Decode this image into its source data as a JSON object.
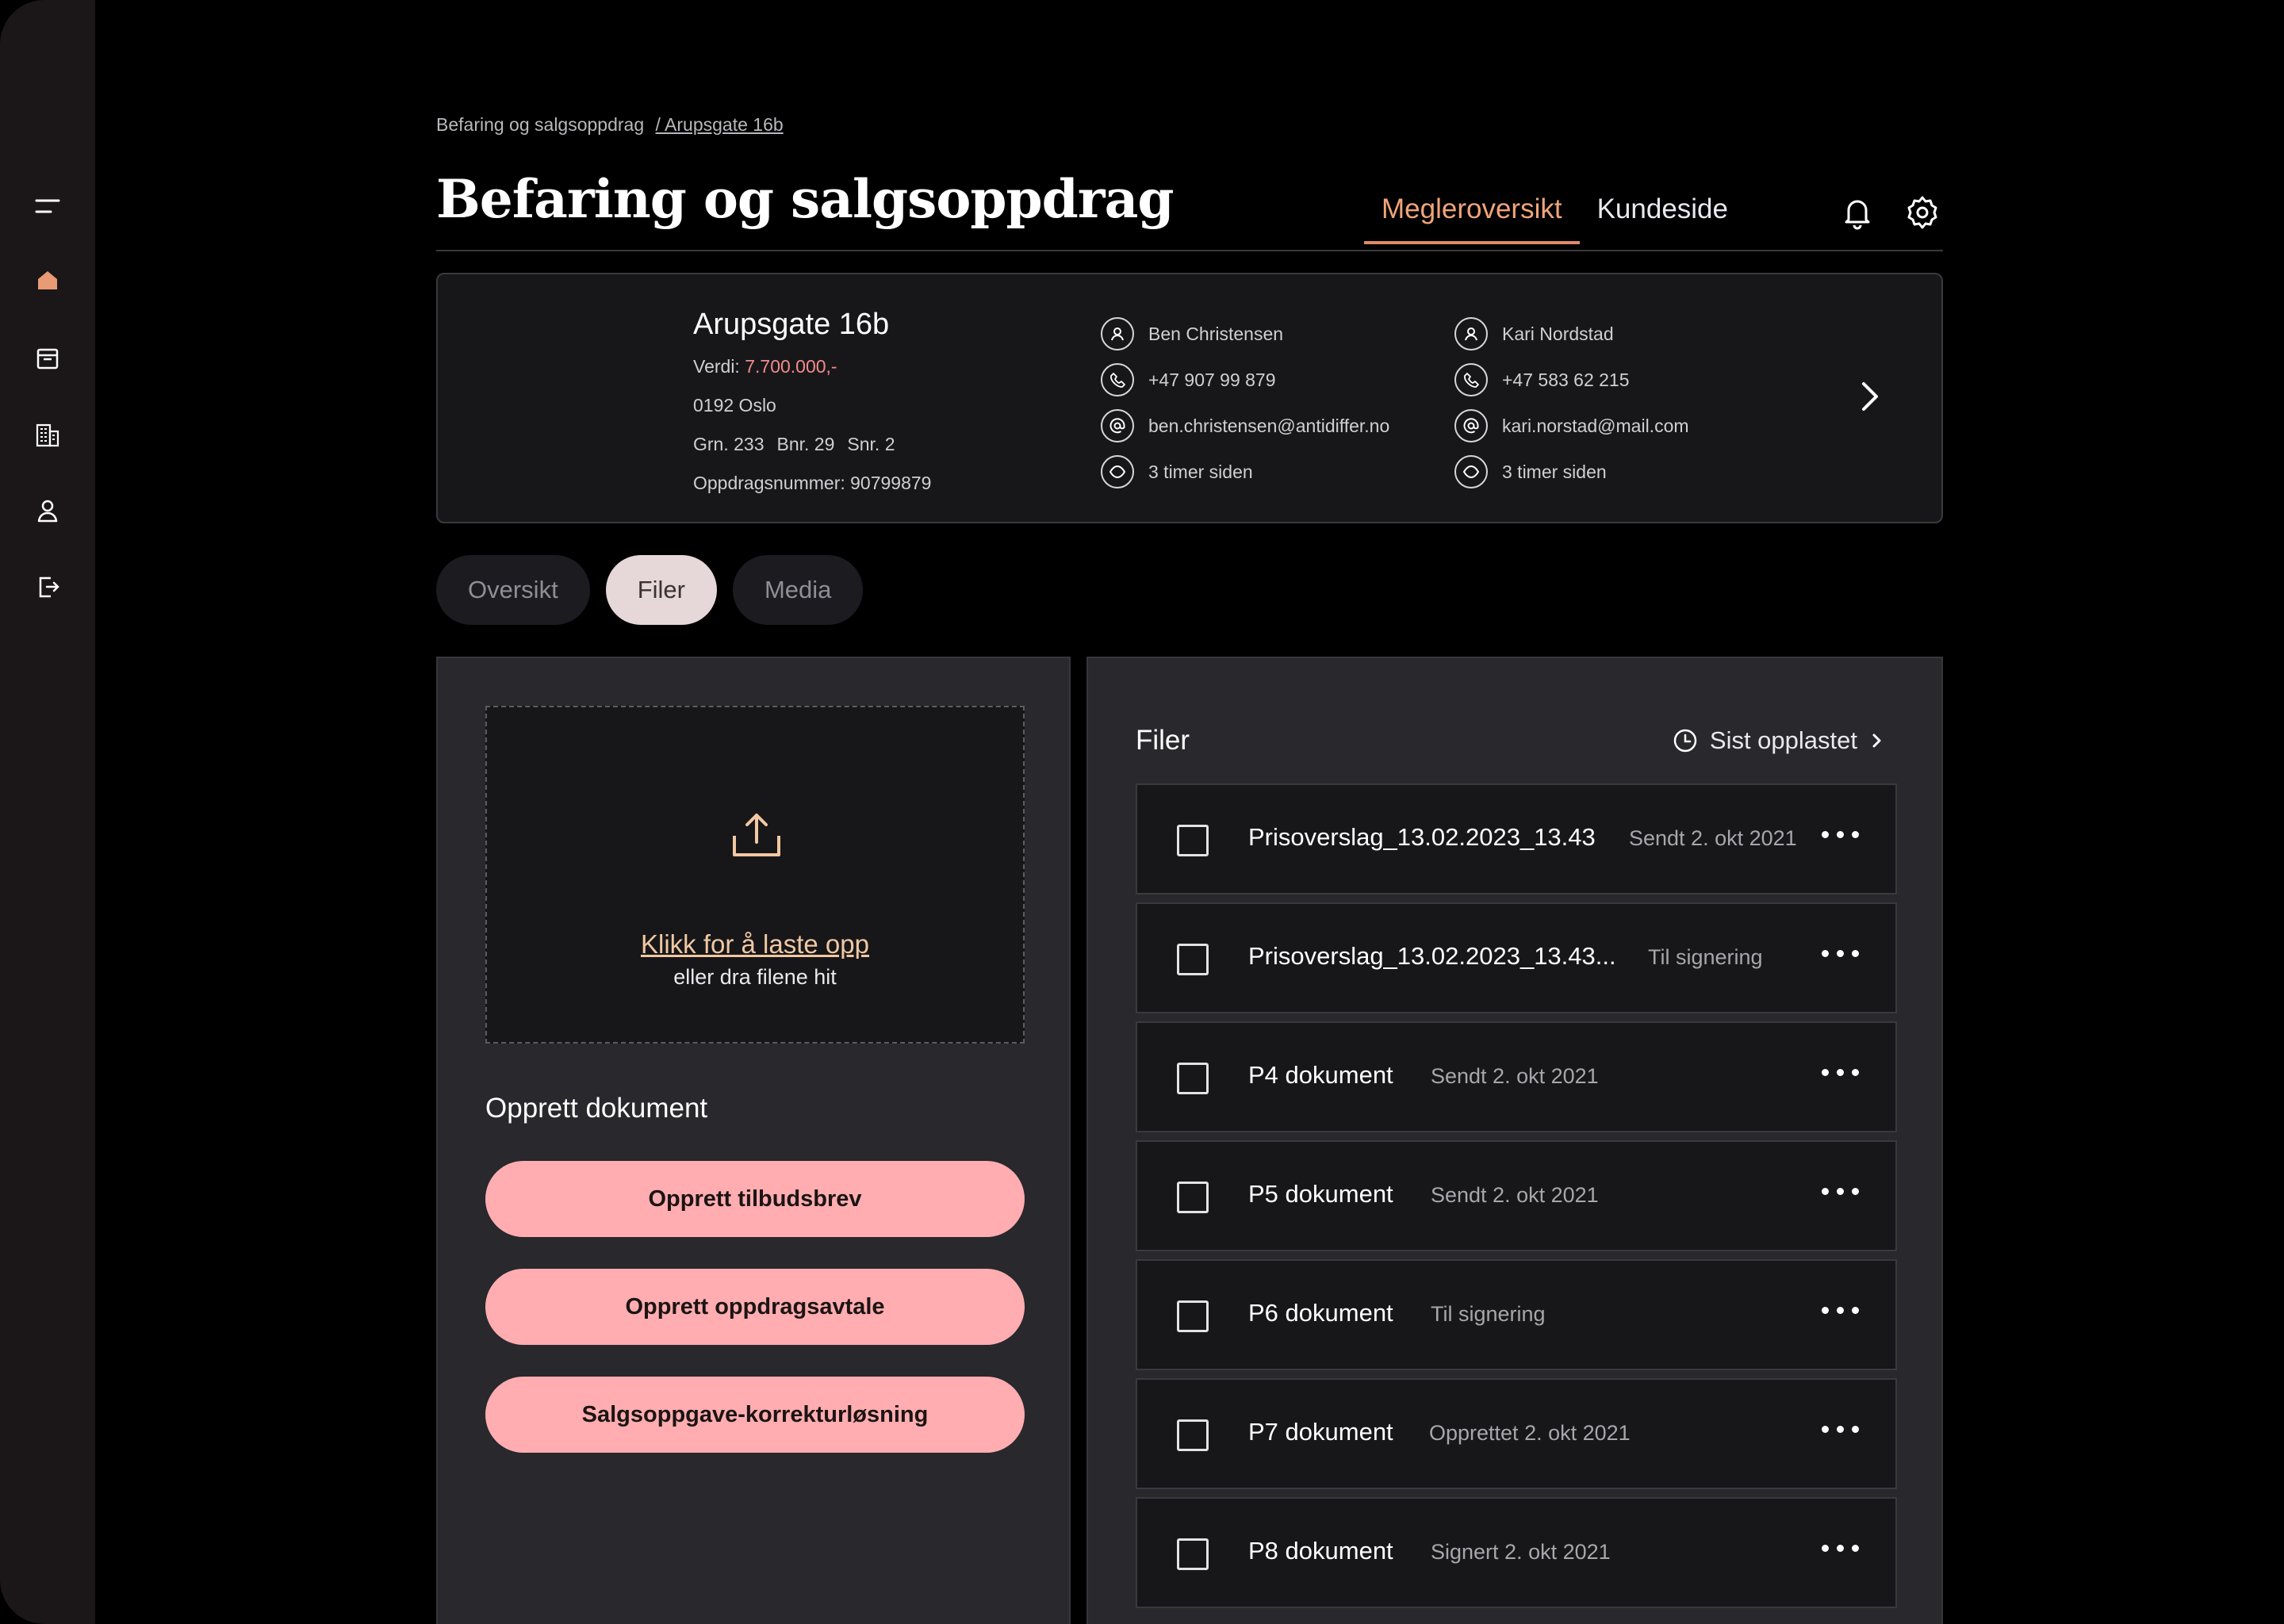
{
  "breadcrumb": {
    "root": "Befaring og salgsoppdrag",
    "current": "/ Arupsgate 16b"
  },
  "page": {
    "title": "Befaring og salgsoppdrag"
  },
  "topnav": {
    "tab_broker": "Megleroversikt",
    "tab_customer": "Kundeside"
  },
  "property": {
    "name": "Arupsgate 16b",
    "value_label": "Verdi:",
    "value": "7.700.000,-",
    "postal": "0192 Oslo",
    "grn": "Grn. 233",
    "bnr": "Bnr. 29",
    "snr": "Snr. 2",
    "assignment": "Oppdragsnummer: 90799879"
  },
  "contacts": [
    {
      "name": "Ben Christensen",
      "phone": "+47 907 99 879",
      "email": "ben.christensen@antidiffer.no",
      "seen": "3 timer siden"
    },
    {
      "name": "Kari Nordstad",
      "phone": "+47 583 62 215",
      "email": "kari.norstad@mail.com",
      "seen": "3 timer siden"
    }
  ],
  "subtabs": {
    "overview": "Oversikt",
    "files": "Filer",
    "media": "Media"
  },
  "upload": {
    "link": "Klikk for å laste opp",
    "sub": "eller dra filene hit"
  },
  "create": {
    "title": "Opprett dokument",
    "btn_offer": "Opprett tilbudsbrev",
    "btn_agreement": "Opprett oppdragsavtale",
    "btn_proof": "Salgsoppgave-korrekturløsning"
  },
  "files": {
    "title": "Filer",
    "sort_label": "Sist opplastet",
    "rows": [
      {
        "name": "Prisoverslag_13.02.2023_13.43",
        "status": "Sendt 2. okt 2021"
      },
      {
        "name": "Prisoverslag_13.02.2023_13.43...",
        "status": "Til signering"
      },
      {
        "name": "P4 dokument",
        "status": "Sendt 2. okt 2021"
      },
      {
        "name": "P5 dokument",
        "status": "Sendt 2. okt 2021"
      },
      {
        "name": "P6 dokument",
        "status": "Til signering"
      },
      {
        "name": "P7 dokument",
        "status": "Opprettet 2. okt 2021"
      },
      {
        "name": "P8 dokument",
        "status": "Signert 2. okt 2021"
      }
    ]
  },
  "colors": {
    "accent": "#e08a68",
    "button": "#ffadb0",
    "price": "#f48a8a",
    "upload_link": "#f1c8a2"
  }
}
